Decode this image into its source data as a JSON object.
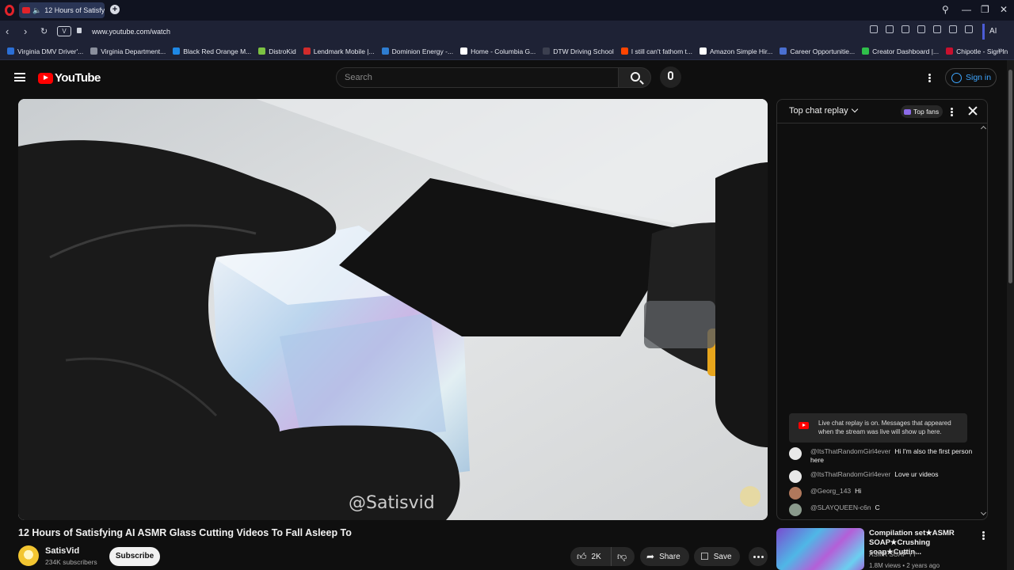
{
  "browser": {
    "tab_title": "12 Hours of Satisfying",
    "url": "www.youtube.com/watch",
    "vpn_badge": "V",
    "ai_button": "AI",
    "bookmarks": [
      {
        "label": "Virginia DMV Driver'...",
        "color": "#2b6fd6"
      },
      {
        "label": "Virginia Department...",
        "color": "#8a8f9c"
      },
      {
        "label": "Black Red Orange M...",
        "color": "#1e88e5"
      },
      {
        "label": "DistroKid",
        "color": "#7cc242"
      },
      {
        "label": "Lendmark Mobile |...",
        "color": "#d12b2b"
      },
      {
        "label": "Dominion Energy -...",
        "color": "#2e7dd1"
      },
      {
        "label": "Home - Columbia G...",
        "color": "#ffffff"
      },
      {
        "label": "DTW Driving School",
        "color": "#3b3f4f"
      },
      {
        "label": "I still can't fathom t...",
        "color": "#ff4500"
      },
      {
        "label": "Amazon Simple Hir...",
        "color": "#ffffff"
      },
      {
        "label": "Career Opportunitie...",
        "color": "#4a6fd0"
      },
      {
        "label": "Creator Dashboard |...",
        "color": "#2fbf4a"
      },
      {
        "label": "Chipotle - Sign In",
        "color": "#c8102e"
      }
    ]
  },
  "youtube": {
    "logo_text": "YouTube",
    "search_placeholder": "Search",
    "sign_in": "Sign in",
    "video": {
      "watermark": "@Satisvid",
      "title": "12 Hours of Satisfying AI ASMR Glass Cutting Videos To Fall Asleep To",
      "channel": "SatisVid",
      "subscribers": "234K subscribers",
      "subscribe": "Subscribe",
      "likes": "2K",
      "share": "Share",
      "save": "Save"
    },
    "chat": {
      "header": "Top chat replay",
      "top_fans": "Top fans",
      "notice": "Live chat replay is on. Messages that appeared when the stream was live will show up here.",
      "messages": [
        {
          "author": "@ItsThatRandomGirl4ever",
          "text": "Hi I'm also the first person here",
          "avatar_color": "#e8e8e8"
        },
        {
          "author": "@ItsThatRandomGirl4ever",
          "text": "Love ur videos",
          "avatar_color": "#e8e8e8"
        },
        {
          "author": "@Georg_143",
          "text": "Hi",
          "avatar_color": "#b0785c"
        },
        {
          "author": "@SLAYQUEEN-c6n",
          "text": "C",
          "avatar_color": "#8a9a8c"
        }
      ]
    },
    "related": {
      "title": "Compilation set★ASMR SOAP★Crushing soap★Cuttin...",
      "channel": "ASMR SOAP YT",
      "meta": "1.8M views • 2 years ago"
    }
  }
}
